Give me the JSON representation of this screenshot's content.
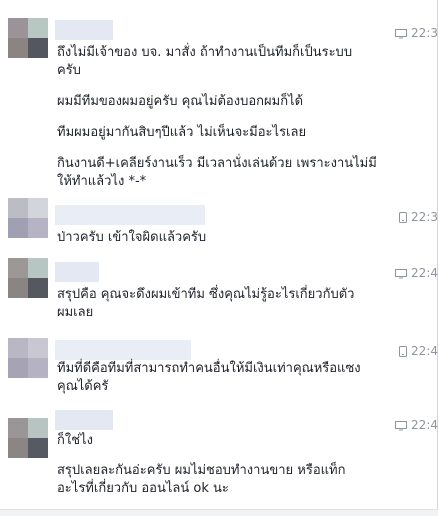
{
  "messages": [
    {
      "time": "22:3",
      "device": "desktop",
      "lines": [
        "ถึงไม่มีเจ้าของ บจ. มาสั่ง ถ้าทำงานเป็นทีมก็เป็นระบบ",
        "ครับ",
        "ผมมีทีมของผมอยู่ครับ คุณไม่ต้องบอกผมก็ได้",
        "ทีมผมอยู่มากันสิบๆปีแล้ว ไม่เห็นจะมีอะไรเลย",
        "กินงานดี+เคลียร์งานเร็ว มีเวลานั่งเล่นด้วย เพราะงานไม่มี",
        "ให้ทำแล้วไง *-*"
      ]
    },
    {
      "time": "22:3",
      "device": "mobile",
      "lines": [
        "ป่าวครับ เข้าใจผิดแล้วครับ"
      ]
    },
    {
      "time": "22:4",
      "device": "desktop",
      "lines": [
        "สรุปคือ คุณจะดึงผมเข้าทีม ซึ่งคุณไม่รู้อะไรเกี่ยวกับตัว",
        "ผมเลย"
      ]
    },
    {
      "time": "22:4",
      "device": "mobile",
      "lines": [
        "ทีมที่ดีคือทีมที่สามารถทำคนอื่นให้มีเงินเท่าคุณหรือแซง",
        "คุณได้ครั"
      ]
    },
    {
      "time": "22:4",
      "device": "desktop",
      "lines": [
        "ก็ใช่ไง",
        "สรุปเลยละกันอ่ะครับ ผมไม่ชอบทำงานขาย หรือแท็ก",
        "อะไรที่เกี่ยวกับ ออนไลน์ ok นะ"
      ]
    }
  ]
}
